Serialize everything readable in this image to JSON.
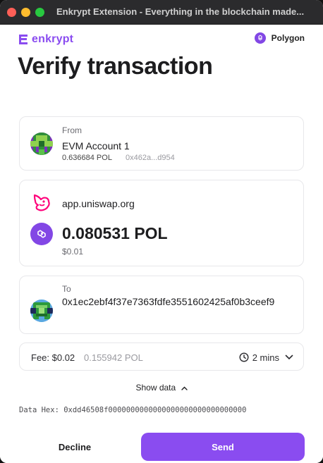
{
  "window": {
    "title": "Enkrypt Extension - Everything in the blockchain made..."
  },
  "brand": {
    "name": "enkrypt",
    "logo_icon": "enkrypt-logo-icon",
    "color": "#8a4cf0"
  },
  "network": {
    "label": "Polygon",
    "icon": "polygon-icon",
    "color": "#8247e5"
  },
  "page": {
    "title": "Verify transaction"
  },
  "from": {
    "label": "From",
    "account_name": "EVM Account 1",
    "balance": "0.636684 POL",
    "address_short": "0x462a...d954"
  },
  "site": {
    "domain": "app.uniswap.org",
    "icon": "uniswap-logo-icon",
    "amount": "0.080531 POL",
    "amount_usd": "$0.01",
    "token_icon": "polygon-token-icon"
  },
  "to": {
    "label": "To",
    "address": "0x1ec2ebf4f37e7363fdfe3551602425af0b3ceef9"
  },
  "fee": {
    "label": "Fee: $0.02",
    "native": "0.155942 POL",
    "time": "2 mins",
    "clock_icon": "clock-icon",
    "chevron_icon": "chevron-down-icon"
  },
  "data_section": {
    "toggle_label": "Show data",
    "toggle_icon": "chevron-up-icon",
    "hex_line": "Data Hex: 0xdd46508f0000000000000000000000000000000"
  },
  "actions": {
    "decline": "Decline",
    "send": "Send"
  },
  "colors": {
    "accent": "#8a4cf0",
    "polygon": "#8247e5",
    "uniswap_pink": "#ff007a"
  }
}
